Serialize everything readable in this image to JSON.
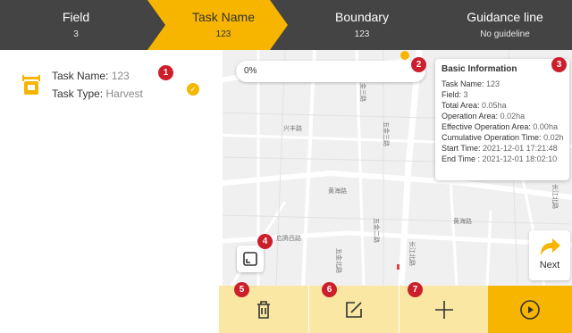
{
  "stepper": {
    "steps": [
      {
        "title": "Field",
        "value": "3"
      },
      {
        "title": "Task Name",
        "value": "123"
      },
      {
        "title": "Boundary",
        "value": "123"
      },
      {
        "title": "Guidance line",
        "value": "No guideline"
      }
    ],
    "active_index": 1
  },
  "task": {
    "name_label": "Task Name:",
    "name_value": "123",
    "type_label": "Task Type:",
    "type_value": "Harvest",
    "selected": true
  },
  "badges": [
    "1",
    "2",
    "3",
    "4",
    "5",
    "6",
    "7"
  ],
  "progress": {
    "value_text": "0%",
    "value": 0
  },
  "info": {
    "title": "Basic Information",
    "rows": [
      {
        "label": "Task Name:",
        "value": "123"
      },
      {
        "label": "Field:",
        "value": "3"
      },
      {
        "label": "Total Area:",
        "value": "0.05ha"
      },
      {
        "label": "Operation Area:",
        "value": "0.02ha"
      },
      {
        "label": "Effective Operation Area:",
        "value": "0.00ha"
      },
      {
        "label": "Cumulative Operation Time:",
        "value": "0.02h"
      },
      {
        "label": "Start Time:",
        "value": "2021-12-01 17:21:48"
      },
      {
        "label": "End Time :",
        "value": "2021-12-01 18:02:10"
      }
    ]
  },
  "map": {
    "road_labels": [
      "兴丰路",
      "黄海路",
      "黄海路",
      "启腾西路",
      "五金北路",
      "五金三路",
      "五金二路",
      "五金三路",
      "长江北路",
      "长江北路"
    ]
  },
  "next": {
    "label": "Next"
  },
  "toolbar": {
    "icons": [
      "trash-icon",
      "edit-icon",
      "plus-icon",
      "play-circle-icon"
    ]
  },
  "colors": {
    "accent": "#f7b500",
    "accent_light": "#f9e7a3",
    "dark_bar": "#444444",
    "badge": "#cc1e2b"
  }
}
